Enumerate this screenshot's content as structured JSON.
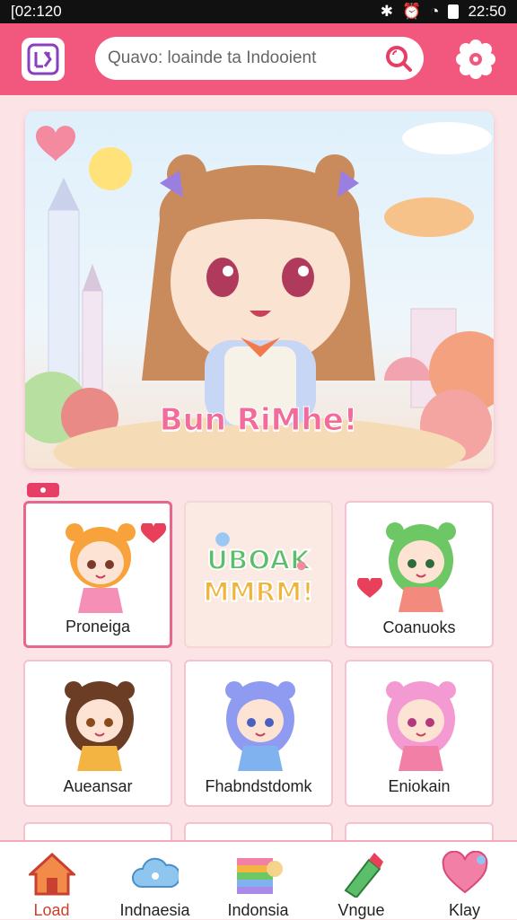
{
  "status_bar": {
    "time_left": "[02:120",
    "time_right": "22:50"
  },
  "header": {
    "search": {
      "value": "Quavo: loainde ta Indooient"
    }
  },
  "banner": {
    "title": "Bun RiMhe!"
  },
  "grid": {
    "cards": [
      {
        "label": "Proneiga",
        "hair": "#f7a23b",
        "dress": "#f58fb5",
        "selected": true
      },
      {
        "label": "",
        "sticker_line1": "UBOAK",
        "sticker_line2": "MMRM!",
        "plain": true
      },
      {
        "label": "Coanuoks",
        "hair": "#6cc764",
        "dress": "#f28a7d"
      },
      {
        "label": "Aueansar",
        "hair": "#6b3d24",
        "dress": "#f4b442"
      },
      {
        "label": "Fhabndstdomk",
        "hair": "#8f9bf0",
        "dress": "#7fb2ef"
      },
      {
        "label": "Eniokain",
        "hair": "#f49ad2",
        "dress": "#f27fa5"
      }
    ]
  },
  "bottom_nav": [
    {
      "label": "Load",
      "icon": "house-icon",
      "active": true
    },
    {
      "label": "Indnaesia",
      "icon": "cloud-icon"
    },
    {
      "label": "Indonsia",
      "icon": "rainbow-icon"
    },
    {
      "label": "Vngue",
      "icon": "crayon-icon"
    },
    {
      "label": "Klay",
      "icon": "heart-icon"
    }
  ],
  "colors": {
    "accent": "#f2577d",
    "card_border": "#e66789",
    "background": "#fbe3e6"
  }
}
